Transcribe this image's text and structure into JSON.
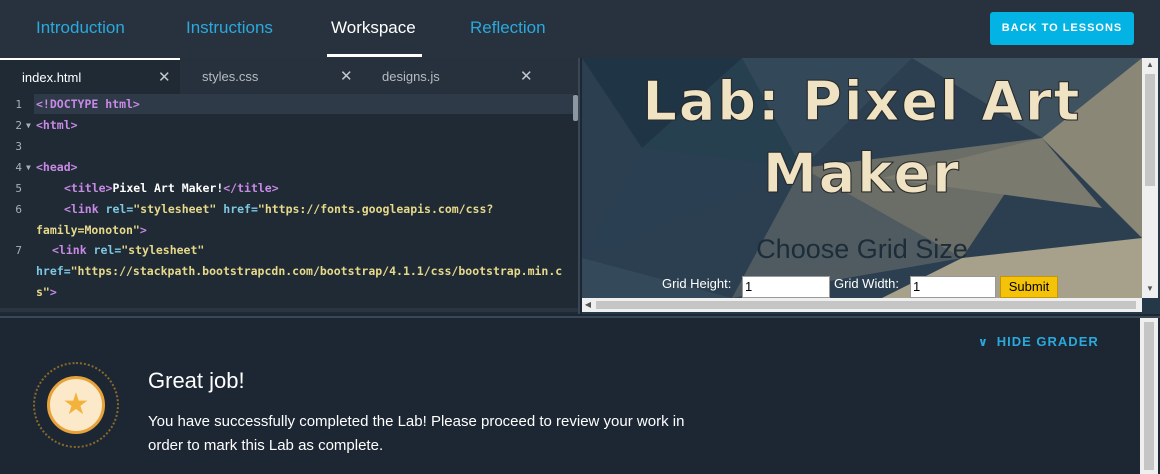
{
  "nav": {
    "tabs": [
      {
        "label": "Introduction"
      },
      {
        "label": "Instructions"
      },
      {
        "label": "Workspace"
      },
      {
        "label": "Reflection"
      }
    ],
    "active_tab": "Workspace",
    "back_label": "BACK TO LESSONS"
  },
  "editor": {
    "files": [
      {
        "name": "index.html",
        "close": "✕"
      },
      {
        "name": "styles.css",
        "close": "✕"
      },
      {
        "name": "designs.js",
        "close": "✕"
      }
    ],
    "active_file": "index.html",
    "line_numbers": [
      "1",
      "2",
      "3",
      "4",
      "5",
      "6",
      "7"
    ],
    "code": {
      "l1": "<!DOCTYPE html>",
      "l2": "<html>",
      "l4": "<head>",
      "l5_open": "<title>",
      "l5_text": "Pixel Art Maker!",
      "l5_close": "</title>",
      "l6_tag": "<link",
      "l6_rel_attr": " rel=",
      "l6_rel_val": "\"stylesheet\"",
      "l6_href_attr": " href=",
      "l6_href_val_a": "\"https://fonts.googleapis.com/css?",
      "l6_href_val_b": "family=Monoton\"",
      "l6_end": ">",
      "l7_tag": "<link",
      "l7_rel_attr": " rel=",
      "l7_rel_val": "\"stylesheet\"",
      "l7_href_attr": "href=",
      "l7_href_val_a": "\"https://stackpath.bootstrapcdn.com/bootstrap/4.1.1/css/bootstrap.min.c",
      "l7_href_val_b": "s\"",
      "l7_end": ">"
    }
  },
  "preview": {
    "title_line1": "Lab: Pixel Art",
    "title_line2": "Maker",
    "subtitle": "Choose Grid Size",
    "height_label": "Grid Height:",
    "height_value": "1",
    "width_label": "Grid Width:",
    "width_value": "1",
    "submit_label": "Submit"
  },
  "grader": {
    "hide_label": "HIDE GRADER",
    "title": "Great job!",
    "message": "You have successfully completed the Lab! Please proceed to review your work in order to mark this Lab as complete."
  },
  "colors": {
    "accent": "#02b3e4",
    "link": "#2aa9dc",
    "background": "#1c2733",
    "badge_star": "#f3b23c",
    "submit": "#f5c20a"
  }
}
